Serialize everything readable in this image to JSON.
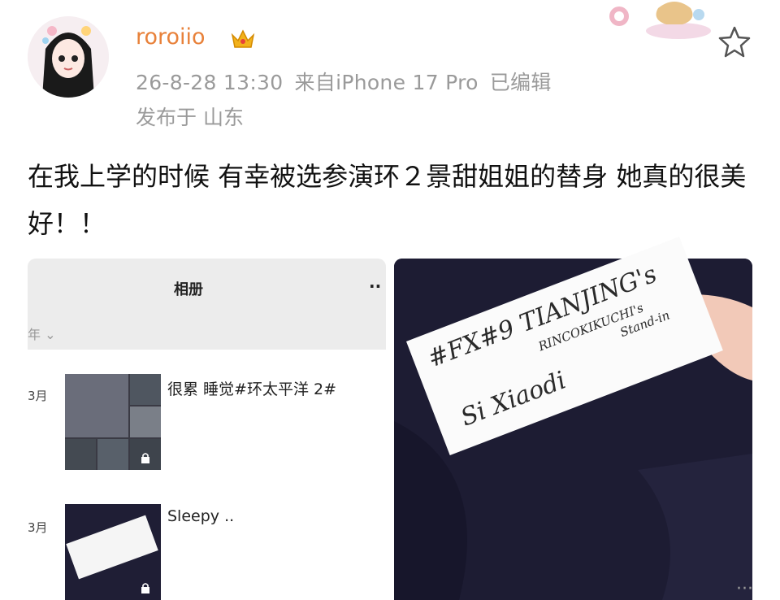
{
  "post": {
    "username": "roroiio",
    "timestamp": "26-8-28 13:30",
    "source": "来自iPhone 17 Pro",
    "edited": "已编辑",
    "location": "发布于 山东",
    "text": "在我上学的时候 有幸被选参演环２景甜姐姐的替身 她真的很美好！！"
  },
  "album": {
    "title": "相册",
    "more": "··",
    "year_partial": "年 ⌄",
    "entries": [
      {
        "month": "3月",
        "caption": "很累 睡觉#环太平洋 2#"
      },
      {
        "month": "3月",
        "caption": "Sleepy .."
      }
    ]
  },
  "note": {
    "line1": "#FX#9 TIANJING's",
    "line2": "RINCOKIKUCHI's",
    "line3": "Stand-in",
    "line4": "Si Xiaodi"
  },
  "icons": {
    "crown": "crown-icon",
    "star": "star-icon",
    "lock": "lock-icon",
    "more": "more-icon"
  },
  "colors": {
    "username": "#e8813a",
    "meta": "#9a9a9a",
    "photo_bg": "#1d1c33"
  }
}
